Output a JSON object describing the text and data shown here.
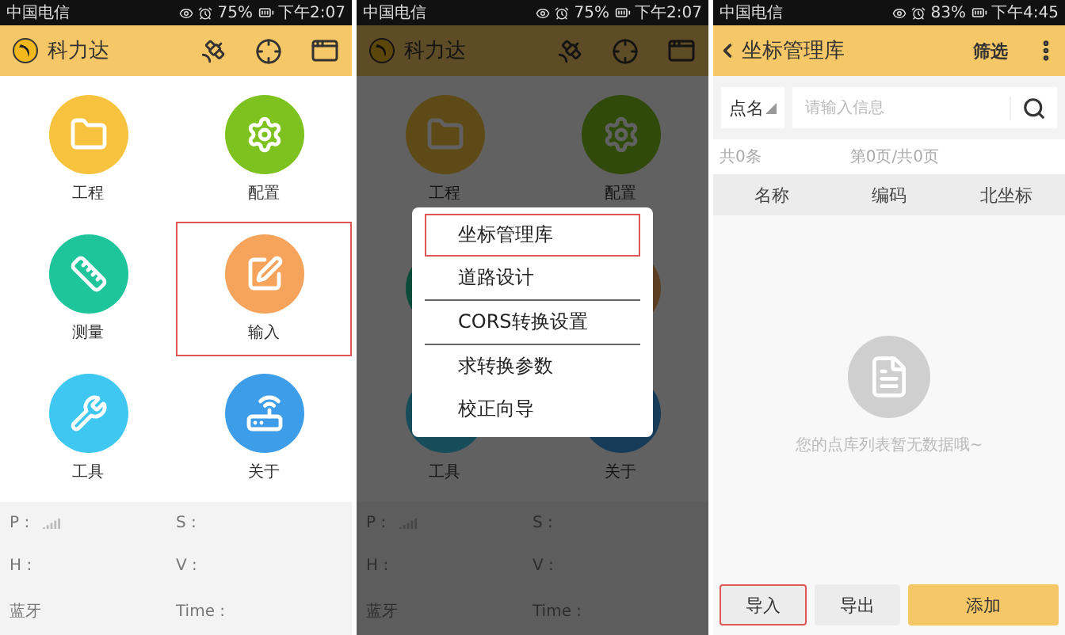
{
  "screens": [
    {
      "kind": "home",
      "dimmed": false,
      "status": {
        "carrier": "中国电信",
        "battery": "75%",
        "time": "下午2:07"
      },
      "app_title": "科力达",
      "tiles": [
        {
          "label": "工程",
          "color": "#f7c23e",
          "highlighted": false
        },
        {
          "label": "配置",
          "color": "#7dc21e",
          "highlighted": false
        },
        {
          "label": "测量",
          "color": "#1ec49a",
          "highlighted": false
        },
        {
          "label": "输入",
          "color": "#f6a35c",
          "highlighted": true
        },
        {
          "label": "工具",
          "color": "#3ec7f0",
          "highlighted": false
        },
        {
          "label": "关于",
          "color": "#3d9de9",
          "highlighted": false
        }
      ],
      "info": [
        "P :",
        "S :",
        "H :",
        "V :",
        "蓝牙",
        "Time :"
      ]
    },
    {
      "kind": "home",
      "dimmed": true,
      "status": {
        "carrier": "中国电信",
        "battery": "75%",
        "time": "下午2:07"
      },
      "app_title": "科力达",
      "tiles": [
        {
          "label": "工程",
          "highlighted": false
        },
        {
          "label": "配置",
          "highlighted": false
        },
        {
          "highlighted": false
        },
        {
          "highlighted": false
        },
        {
          "label": "工具",
          "highlighted": false
        },
        {
          "label": "关于",
          "highlighted": false
        }
      ],
      "info": [
        "P :",
        "S :",
        "H :",
        "V :",
        "蓝牙",
        "Time :"
      ],
      "menu_groups": [
        [
          {
            "label": "坐标管理库",
            "highlighted": true
          },
          {
            "label": "道路设计",
            "highlighted": false
          }
        ],
        [
          {
            "label": "CORS转换设置",
            "highlighted": false
          }
        ],
        [
          {
            "label": "求转换参数",
            "highlighted": false
          },
          {
            "label": "校正向导",
            "highlighted": false
          }
        ]
      ]
    },
    {
      "kind": "library",
      "status": {
        "carrier": "中国电信",
        "battery": "83%",
        "time": "下午4:45"
      },
      "title": "坐标管理库",
      "filter": "筛选",
      "search": {
        "field": "点名",
        "placeholder": "请输入信息"
      },
      "count": "共0条",
      "pages": "第0页/共0页",
      "columns": [
        "名称",
        "编码",
        "北坐标"
      ],
      "empty_text": "您的点库列表暂无数据哦~",
      "buttons": [
        {
          "label": "导入",
          "kind": "default",
          "highlighted": true
        },
        {
          "label": "导出",
          "kind": "default",
          "highlighted": false
        },
        {
          "label": "添加",
          "kind": "primary",
          "highlighted": false
        }
      ]
    }
  ]
}
